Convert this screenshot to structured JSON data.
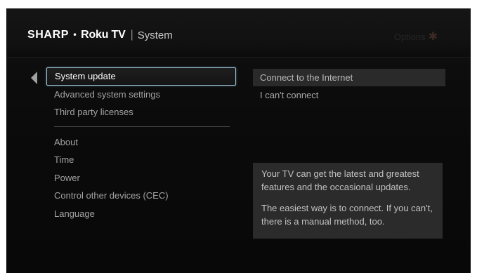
{
  "header": {
    "brand_sharp": "SHARP",
    "brand_dot": "•",
    "brand_roku": "Roku TV",
    "separator": "|",
    "section_title": "System",
    "options_label": "Options",
    "options_icon": "✱"
  },
  "menu": {
    "back_icon": "left-triangle",
    "items": [
      {
        "label": "System update",
        "selected": true
      },
      {
        "label": "Advanced system settings"
      },
      {
        "label": "Third party licenses"
      },
      {
        "label": "About"
      },
      {
        "label": "Time"
      },
      {
        "label": "Power"
      },
      {
        "label": "Control other devices (CEC)"
      },
      {
        "label": "Language"
      }
    ]
  },
  "submenu": {
    "items": [
      {
        "label": "Connect to the Internet",
        "highlighted": true
      },
      {
        "label": "I can't connect"
      }
    ]
  },
  "info": {
    "paragraph_1": "Your TV can get the latest and greatest features and the occasional updates.",
    "paragraph_2": "The easiest way is to connect.  If you can't, there is a manual method, too."
  },
  "colors": {
    "background": "#0d0d0d",
    "focus_border": "#9fc3d6",
    "text_dim": "#a3a3a3",
    "info_box": "#2b2b2b"
  }
}
